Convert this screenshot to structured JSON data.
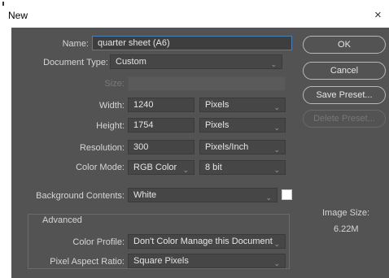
{
  "window": {
    "title": "New",
    "close_glyph": "×"
  },
  "form": {
    "name_label": "Name:",
    "name_value": "quarter sheet (A6)",
    "doctype_label": "Document Type:",
    "doctype_value": "Custom",
    "size_label": "Size:",
    "width_label": "Width:",
    "width_value": "1240",
    "width_unit": "Pixels",
    "height_label": "Height:",
    "height_value": "1754",
    "height_unit": "Pixels",
    "resolution_label": "Resolution:",
    "resolution_value": "300",
    "resolution_unit": "Pixels/Inch",
    "colormode_label": "Color Mode:",
    "colormode_value": "RGB Color",
    "bitdepth_value": "8 bit",
    "bg_label": "Background Contents:",
    "bg_value": "White",
    "advanced_label": "Advanced",
    "profile_label": "Color Profile:",
    "profile_value": "Don't Color Manage this Document",
    "pixel_ratio_label": "Pixel Aspect Ratio:",
    "pixel_ratio_value": "Square Pixels"
  },
  "buttons": {
    "ok": "OK",
    "cancel": "Cancel",
    "save_preset": "Save Preset...",
    "delete_preset": "Delete Preset..."
  },
  "image_size": {
    "label": "Image Size:",
    "value": "6.22M"
  },
  "icons": {
    "chevron": "⌄"
  }
}
